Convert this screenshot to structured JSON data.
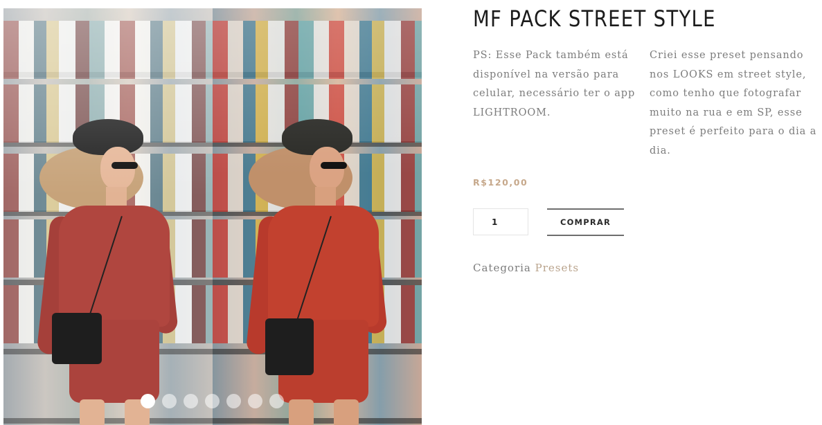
{
  "gallery": {
    "image_alt": "Woman in red outfit with black cap in front of magazine stand, before and after preset comparison",
    "dots_count": 7,
    "active_dot": 1
  },
  "product": {
    "title": "MF PACK STREET STYLE",
    "description_left": "PS: Esse Pack também está disponível na versão para celular, necessário ter o app LIGHTROOM.",
    "description_right": "Criei esse preset pensando nos LOOKS em street style, como tenho que fotografar muito na rua e em SP, esse preset é perfeito para o dia a dia.",
    "price": "R$120,00",
    "quantity": "1",
    "buy_label": "COMPRAR",
    "category_label": "Categoria",
    "category_link": "Presets"
  },
  "colors": {
    "price": "#c6a88b",
    "category_link": "#b9a38c",
    "text": "#7c7c7c",
    "title": "#1b1b1b"
  }
}
